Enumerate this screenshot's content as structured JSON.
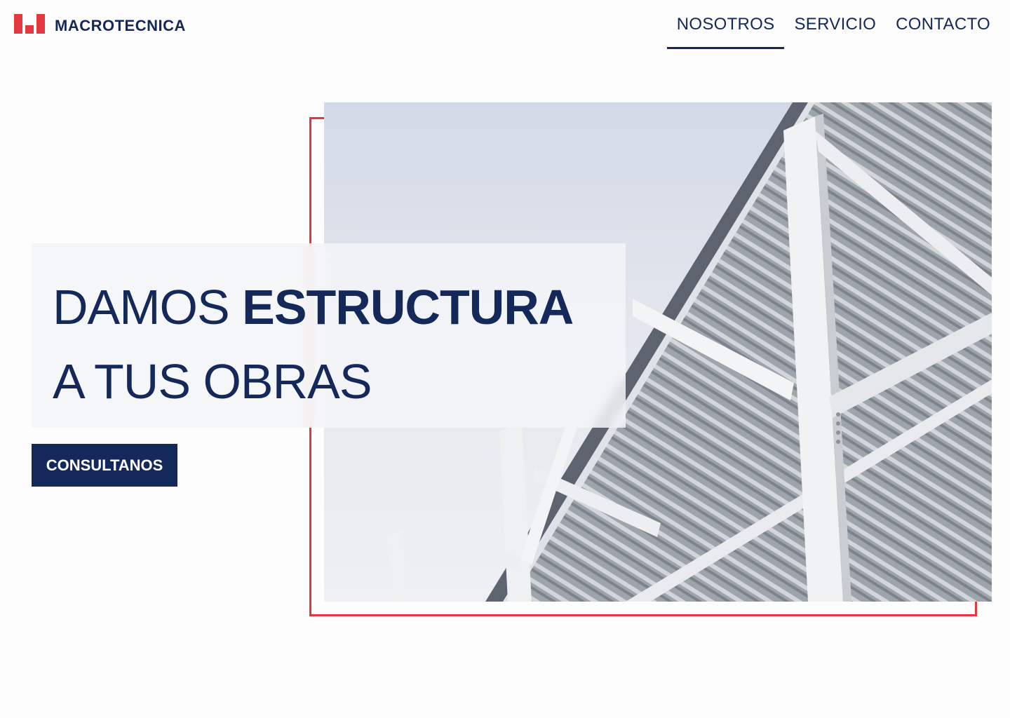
{
  "brand": {
    "name": "MACROTECNICA",
    "accent_color": "#e3393e",
    "primary_color": "#14285a"
  },
  "nav": {
    "items": [
      {
        "label": "NOSOTROS",
        "active": true
      },
      {
        "label": "SERVICIO",
        "active": false
      },
      {
        "label": "CONTACTO",
        "active": false
      }
    ]
  },
  "hero": {
    "headline_light_1": "DAMOS",
    "headline_bold_1": "ESTRUCTURA",
    "headline_line_2": "A TUS OBRAS",
    "cta_label": "CONSULTANOS",
    "image_subject": "steel-structure-photo"
  }
}
